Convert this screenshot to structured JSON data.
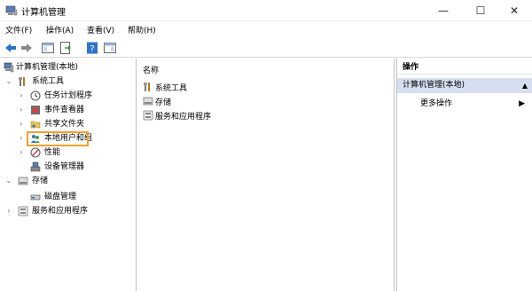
{
  "window": {
    "title": "计算机管理",
    "min_label": "—",
    "max_label": "☐",
    "close_label": "✕"
  },
  "menu": {
    "items": [
      "文件(F)",
      "操作(A)",
      "查看(V)",
      "帮助(H)"
    ]
  },
  "tree": {
    "root": "计算机管理(本地)",
    "system_tools": "系统工具",
    "task_scheduler": "任务计划程序",
    "event_viewer": "事件查看器",
    "shared_folders": "共享文件夹",
    "local_users": "本地用户和组",
    "performance": "性能",
    "device_manager": "设备管理器",
    "storage": "存储",
    "disk_management": "磁盘管理",
    "services": "服务和应用程序",
    "expander_open": "⌄",
    "expander_closed": "›"
  },
  "middle": {
    "column_header": "名称",
    "items": [
      "系统工具",
      "存储",
      "服务和应用程序"
    ]
  },
  "actions": {
    "header": "操作",
    "selected": "计算机管理(本地)",
    "more": "更多操作",
    "up_arrow": "▲",
    "more_arrow": "▶"
  },
  "colors": {
    "highlight_border": "#f0a030",
    "selection_bg": "#d5dff0",
    "toolbar_accent": "#2f73c4"
  }
}
